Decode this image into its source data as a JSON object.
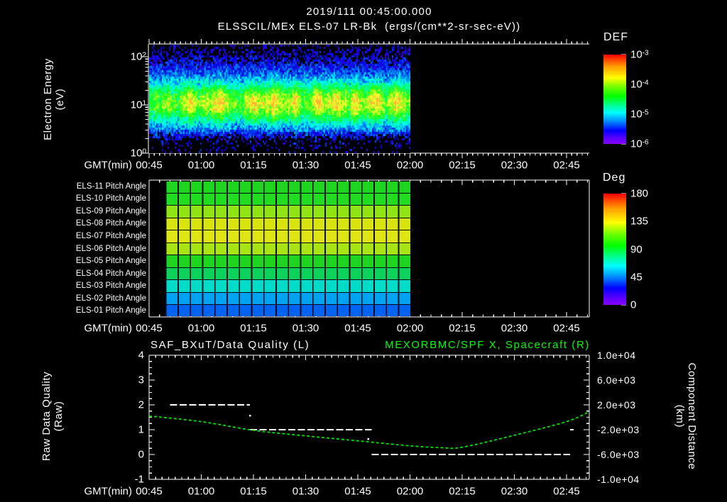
{
  "title": {
    "line1": "2019/111 00:45:00.000",
    "line2": "ELSSCIL/MEx ELS-07 LR-Bk  (ergs/(cm**2-sr-sec-eV))"
  },
  "time_axis": {
    "label": "GMT(min)",
    "ticks": [
      "00:45",
      "01:00",
      "01:15",
      "01:30",
      "01:45",
      "02:00",
      "02:15",
      "02:30",
      "02:45"
    ]
  },
  "panel1": {
    "ylabel_line1": "Electron Energy",
    "ylabel_line2": "(eV)",
    "ytick_base": "10",
    "ytick_exponents": [
      "2",
      "1",
      "0"
    ],
    "colorbar": {
      "title": "DEF",
      "tick_base": "10",
      "tick_exponents": [
        "-3",
        "-4",
        "-5",
        "-6"
      ]
    }
  },
  "panel2": {
    "row_labels": [
      "ELS-11 Pitch Angle",
      "ELS-10 Pitch Angle",
      "ELS-09 Pitch Angle",
      "ELS-08 Pitch Angle",
      "ELS-07 Pitch Angle",
      "ELS-06 Pitch Angle",
      "ELS-05 Pitch Angle",
      "ELS-04 Pitch Angle",
      "ELS-03 Pitch Angle",
      "ELS-02 Pitch Angle",
      "ELS-01 Pitch Angle"
    ],
    "row_colors": [
      "#1ed41e",
      "#22dc22",
      "#90e414",
      "#d8e410",
      "#dfe414",
      "#a8e414",
      "#1ed41e",
      "#0cd25c",
      "#00dcc8",
      "#00a2f2",
      "#0064f0"
    ],
    "colorbar": {
      "title": "Deg",
      "ticks": [
        "180",
        "135",
        "90",
        "45",
        "0"
      ]
    }
  },
  "panel3": {
    "title_left": "SAF_BXuT/Data Quality (L)",
    "title_right": "MEXORBMC/SPF X, Spacecraft (R)",
    "ylabel_left_line1": "Raw Data Quality",
    "ylabel_left_line2": "(Raw)",
    "yticks_left": [
      "4",
      "3",
      "2",
      "1",
      "0",
      "-1"
    ],
    "ylabel_right_line1": "Component Distance",
    "ylabel_right_line2": "(km)",
    "yticks_right": [
      "1.0e+04",
      "6.0e+03",
      "2.0e+03",
      "-2.0e+03",
      "-6.0e+03",
      "-1.0e+04"
    ]
  },
  "colors": {
    "background": "#000000",
    "axis": "#ffffff",
    "text": "#ffffff",
    "accent_green": "#00ff00",
    "curve_green": "#00e400",
    "quality_white": "#ffffff"
  },
  "chart_data": [
    {
      "type": "heatmap",
      "name": "electron-energy-spectrogram",
      "title": "ELSSCIL/MEx ELS-07 LR-Bk",
      "units": "ergs/(cm**2-sr-sec-eV)",
      "colorbar_title": "DEF",
      "value_scale": "log",
      "value_range": [
        1e-06,
        0.001
      ],
      "y_axis": "Electron Energy (eV)",
      "y_scale": "log",
      "y_range": [
        1,
        180
      ],
      "x_axis": "GMT(min)",
      "x_range": [
        "00:45",
        "02:52"
      ],
      "data_extent": [
        "00:45",
        "02:00"
      ],
      "description": "Noisy rainbow spectrogram: violet/blue background with black speckle, enhanced flux band ~4-30 eV (cyan/green, bursts to yellow ~1e-4); no data after 02:00.",
      "burst_times_gmt": [
        "00:57",
        "01:05",
        "01:15",
        "01:21",
        "01:27",
        "01:33",
        "01:38",
        "01:44",
        "01:50",
        "01:56"
      ],
      "seed": 1311
    },
    {
      "type": "heatmap",
      "name": "pitch-angle-panel",
      "colorbar_title": "Deg",
      "colorbar_range": [
        0,
        180
      ],
      "x_extent": [
        "00:50",
        "02:00"
      ],
      "rows": [
        {
          "sensor": "ELS-11",
          "pitch_angle_deg": 96
        },
        {
          "sensor": "ELS-10",
          "pitch_angle_deg": 98
        },
        {
          "sensor": "ELS-09",
          "pitch_angle_deg": 113
        },
        {
          "sensor": "ELS-08",
          "pitch_angle_deg": 122
        },
        {
          "sensor": "ELS-07",
          "pitch_angle_deg": 124
        },
        {
          "sensor": "ELS-06",
          "pitch_angle_deg": 115
        },
        {
          "sensor": "ELS-05",
          "pitch_angle_deg": 96
        },
        {
          "sensor": "ELS-04",
          "pitch_angle_deg": 84
        },
        {
          "sensor": "ELS-03",
          "pitch_angle_deg": 68
        },
        {
          "sensor": "ELS-02",
          "pitch_angle_deg": 57
        },
        {
          "sensor": "ELS-01",
          "pitch_angle_deg": 45
        }
      ]
    },
    {
      "type": "line",
      "name": "quality-and-spacecraft-x",
      "ylim_left": [
        -1,
        4
      ],
      "ylim_right": [
        -10000,
        10000
      ],
      "series": [
        {
          "name": "SAF_BXuT/Data Quality (L)",
          "axis": "left",
          "style": "white dashed horizontal segments",
          "segments": [
            {
              "start_gmt": "00:51",
              "end_gmt": "01:14",
              "value": 2
            },
            {
              "start_gmt": "01:14",
              "end_gmt": "01:49",
              "value": 1
            },
            {
              "start_gmt": "01:49",
              "end_gmt": "02:46",
              "value": 0
            },
            {
              "start_gmt": "02:46",
              "end_gmt": "02:47",
              "value": 1
            }
          ],
          "transition_dots": [
            {
              "gmt": "01:14",
              "value": 1.57
            },
            {
              "gmt": "01:48",
              "value": 0.63
            }
          ]
        },
        {
          "name": "MEXORBMC/SPF X, Spacecraft (R)",
          "axis": "right",
          "style": "green dashed curve",
          "points_gmt_km": [
            [
              "00:45",
              200
            ],
            [
              "01:00",
              -700
            ],
            [
              "01:15",
              -2100
            ],
            [
              "01:30",
              -3000
            ],
            [
              "01:45",
              -3800
            ],
            [
              "02:00",
              -4600
            ],
            [
              "02:09",
              -4900
            ],
            [
              "02:15",
              -4830
            ],
            [
              "02:30",
              -2900
            ],
            [
              "02:45",
              -700
            ],
            [
              "02:52",
              900
            ]
          ]
        }
      ]
    }
  ]
}
